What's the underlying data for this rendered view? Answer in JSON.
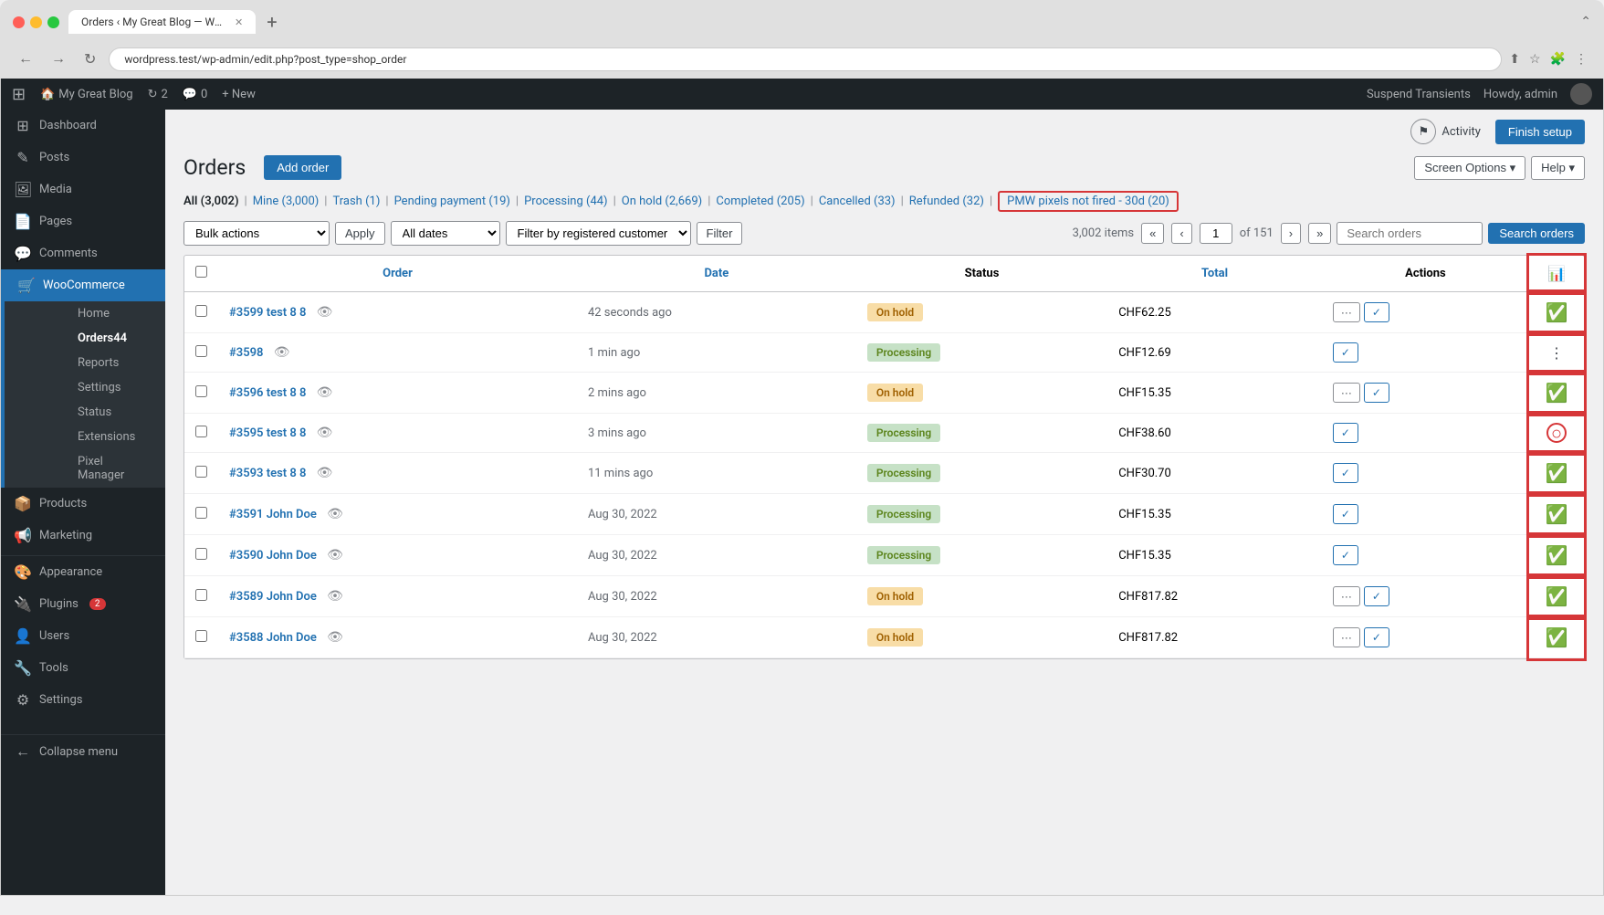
{
  "browser": {
    "tab_title": "Orders ‹ My Great Blog — Wo...",
    "url": "wordpress.test/wp-admin/edit.php?post_type=shop_order"
  },
  "admin_bar": {
    "site_name": "My Great Blog",
    "updates_count": "2",
    "comments_count": "0",
    "new_label": "+ New",
    "suspend_transients": "Suspend Transients",
    "howdy": "Howdy, admin"
  },
  "sidebar": {
    "items": [
      {
        "label": "Dashboard",
        "icon": "⊞",
        "active": false
      },
      {
        "label": "Posts",
        "icon": "✎",
        "active": false
      },
      {
        "label": "Media",
        "icon": "🖼",
        "active": false
      },
      {
        "label": "Pages",
        "icon": "📄",
        "active": false
      },
      {
        "label": "Comments",
        "icon": "💬",
        "active": false
      },
      {
        "label": "WooCommerce",
        "icon": "🛒",
        "active": true
      },
      {
        "label": "Products",
        "icon": "📦",
        "active": false
      },
      {
        "label": "Marketing",
        "icon": "📢",
        "active": false
      },
      {
        "label": "Appearance",
        "icon": "🎨",
        "active": false
      },
      {
        "label": "Plugins",
        "icon": "🔌",
        "badge": "2",
        "active": false
      },
      {
        "label": "Users",
        "icon": "👤",
        "active": false
      },
      {
        "label": "Tools",
        "icon": "🔧",
        "active": false
      },
      {
        "label": "Settings",
        "icon": "⚙",
        "active": false
      }
    ],
    "woo_sub": [
      {
        "label": "Home",
        "active": false
      },
      {
        "label": "Orders",
        "badge": "44",
        "active": true
      },
      {
        "label": "Reports",
        "active": false
      },
      {
        "label": "Settings",
        "active": false
      },
      {
        "label": "Status",
        "active": false
      },
      {
        "label": "Extensions",
        "active": false
      },
      {
        "label": "Pixel Manager",
        "active": false
      }
    ],
    "collapse_label": "Collapse menu"
  },
  "page": {
    "title": "Orders",
    "breadcrumb": "Orders",
    "add_order_btn": "Add order",
    "screen_options_btn": "Screen Options ▾",
    "help_btn": "Help ▾",
    "activity_label": "Activity",
    "finish_setup_label": "Finish setup"
  },
  "filter_tabs": [
    {
      "label": "All",
      "count": "(3,002)",
      "active": true
    },
    {
      "label": "Mine",
      "count": "(3,000)"
    },
    {
      "label": "Trash",
      "count": "(1)"
    },
    {
      "label": "Pending payment",
      "count": "(19)"
    },
    {
      "label": "Processing",
      "count": "(44)"
    },
    {
      "label": "On hold",
      "count": "(2,669)"
    },
    {
      "label": "Completed",
      "count": "(205)"
    },
    {
      "label": "Cancelled",
      "count": "(33)"
    },
    {
      "label": "Refunded",
      "count": "(32)"
    },
    {
      "label": "PMW pixels not fired - 30d",
      "count": "(20)",
      "highlight": true
    }
  ],
  "controls": {
    "bulk_actions_label": "Bulk actions",
    "apply_label": "Apply",
    "all_dates_label": "All dates",
    "customer_placeholder": "Filter by registered customer",
    "filter_label": "Filter",
    "items_count": "3,002 items",
    "search_orders_label": "Search orders",
    "page_current": "1",
    "page_total": "151"
  },
  "table": {
    "columns": [
      "",
      "Order",
      "Date",
      "Status",
      "Total",
      "Actions",
      "PMW"
    ],
    "rows": [
      {
        "id": "#3599 test 8 8",
        "date": "42 seconds ago",
        "status": "On hold",
        "status_class": "on-hold",
        "total": "CHF62.25",
        "has_dots": true,
        "pmw": "check-green"
      },
      {
        "id": "#3598",
        "date": "1 min ago",
        "status": "Processing",
        "status_class": "processing",
        "total": "CHF12.69",
        "has_dots": false,
        "pmw": "dots"
      },
      {
        "id": "#3596 test 8 8",
        "date": "2 mins ago",
        "status": "On hold",
        "status_class": "on-hold",
        "total": "CHF15.35",
        "has_dots": true,
        "pmw": "check-green"
      },
      {
        "id": "#3595 test 8 8",
        "date": "3 mins ago",
        "status": "Processing",
        "status_class": "processing",
        "total": "CHF38.60",
        "has_dots": false,
        "pmw": "circle-red"
      },
      {
        "id": "#3593 test 8 8",
        "date": "11 mins ago",
        "status": "Processing",
        "status_class": "processing",
        "total": "CHF30.70",
        "has_dots": false,
        "pmw": "check-green"
      },
      {
        "id": "#3591 John Doe",
        "date": "Aug 30, 2022",
        "status": "Processing",
        "status_class": "processing",
        "total": "CHF15.35",
        "has_dots": false,
        "pmw": "check-green"
      },
      {
        "id": "#3590 John Doe",
        "date": "Aug 30, 2022",
        "status": "Processing",
        "status_class": "processing",
        "total": "CHF15.35",
        "has_dots": false,
        "pmw": "check-green"
      },
      {
        "id": "#3589 John Doe",
        "date": "Aug 30, 2022",
        "status": "On hold",
        "status_class": "on-hold",
        "total": "CHF817.82",
        "has_dots": true,
        "pmw": "check-green"
      },
      {
        "id": "#3588 John Doe",
        "date": "Aug 30, 2022",
        "status": "On hold",
        "status_class": "on-hold",
        "total": "CHF817.82",
        "has_dots": true,
        "pmw": "check-green"
      }
    ]
  }
}
